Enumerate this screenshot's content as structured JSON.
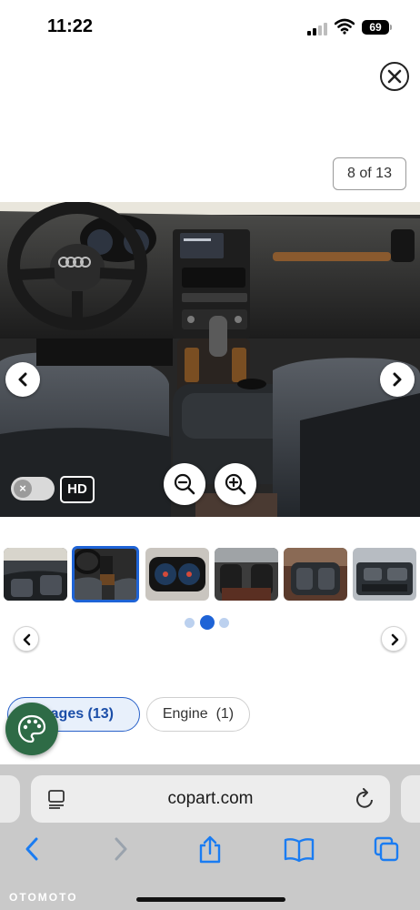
{
  "status_bar": {
    "time": "11:22",
    "battery": "69",
    "icons": [
      "signal-icon",
      "wifi-icon",
      "battery-icon"
    ]
  },
  "viewer": {
    "counter": "8 of 13",
    "close_icon": "close-icon",
    "hd_label": "HD",
    "toggle_label": "×",
    "icons": [
      "chevron-left-icon",
      "chevron-right-icon",
      "zoom-out-icon",
      "zoom-in-icon"
    ]
  },
  "thumbnails": {
    "count_visible": 6,
    "selected_index": 1,
    "pager_dots": 3,
    "active_dot": 1
  },
  "tabs": [
    {
      "label": "Images (13)",
      "active": true
    },
    {
      "label": "Engine  (1)",
      "active": false
    }
  ],
  "fab": {
    "icon": "palette-icon"
  },
  "browser": {
    "url": "copart.com",
    "icons": [
      "page-icon",
      "reload-icon",
      "back-icon",
      "forward-icon",
      "share-icon",
      "bookmarks-icon",
      "tabs-icon"
    ]
  },
  "watermark": "OTOMOTO",
  "colors": {
    "accent_blue": "#1e63d6",
    "tab_active_bg": "#e8f0fb",
    "fab_green": "#2e6b46",
    "browser_bar": "#c9c9c9",
    "ios_blue": "#1a7cf2"
  }
}
